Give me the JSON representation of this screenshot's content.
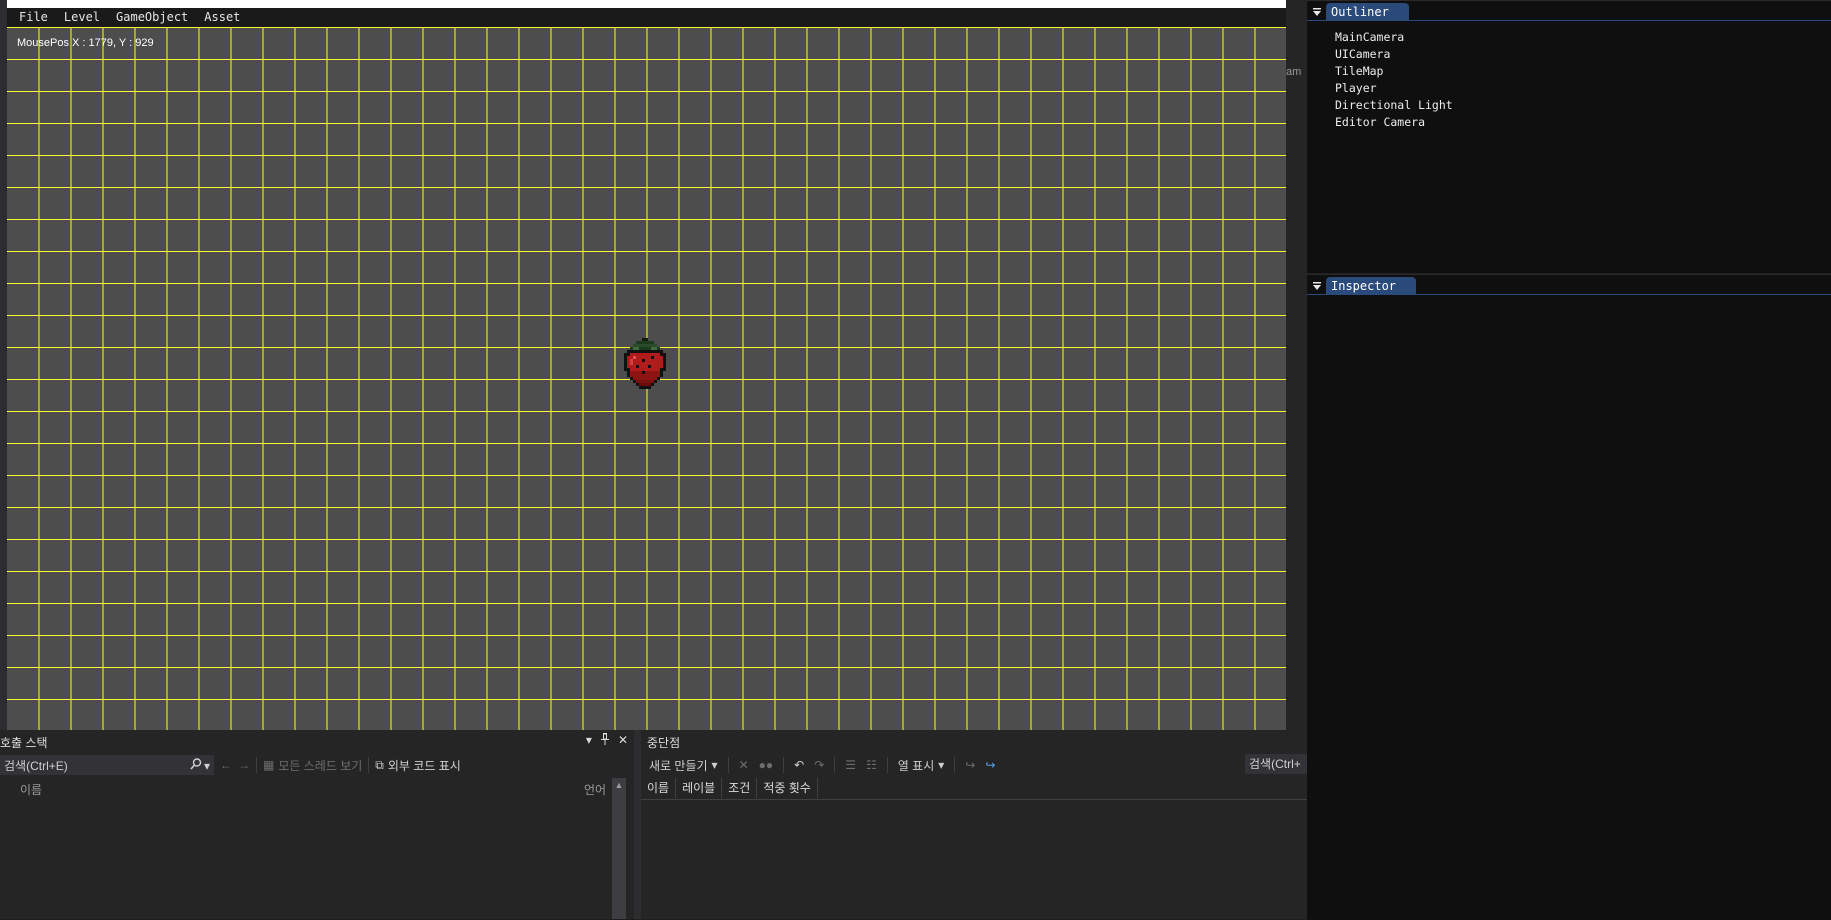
{
  "game_window": {
    "menu": [
      "File",
      "Level",
      "GameObject",
      "Asset"
    ],
    "mouse_pos_text": "MousePos X : 1779, Y : 929",
    "sprite": "strawberry-sprite",
    "colors": {
      "background": "#4d4d4d",
      "grid_line": "#ffff33"
    }
  },
  "gutter": {
    "label": "am"
  },
  "outliner": {
    "tab_label": "Outliner",
    "items": [
      "MainCamera",
      "UICamera",
      "TileMap",
      "Player",
      "Directional Light",
      "Editor Camera"
    ]
  },
  "inspector": {
    "tab_label": "Inspector"
  },
  "callstack": {
    "title": "호출 스택",
    "search_placeholder": "검색(Ctrl+E)",
    "show_all_threads": "모든 스레드 보기",
    "show_external_code": "외부 코드 표시",
    "columns": [
      "이름",
      "언어"
    ]
  },
  "breakpoints": {
    "title": "중단점",
    "new_label": "새로 만들기",
    "columns_label": "열 표시",
    "search_label": "검색(Ctrl+",
    "columns": [
      "이름",
      "레이블",
      "조건",
      "적중 횟수"
    ]
  },
  "accent_colors": {
    "panel_tab": "#294a7a",
    "vs_bg": "#252526"
  }
}
